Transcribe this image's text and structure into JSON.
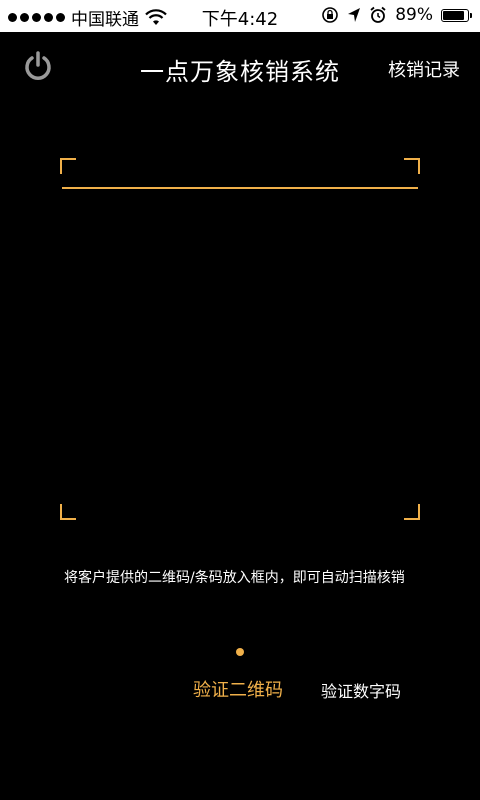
{
  "status_bar": {
    "carrier": "中国联通",
    "time": "下午4:42",
    "battery_percent": "89%",
    "battery_level": 0.89
  },
  "header": {
    "title": "一点万象核销系统",
    "records_label": "核销记录"
  },
  "scanner": {
    "hint": "将客户提供的二维码/条码放入框内，即可自动扫描核销"
  },
  "modes": {
    "qr_label": "验证二维码",
    "numeric_label": "验证数字码"
  },
  "colors": {
    "accent": "#f0b04a",
    "background": "#000000",
    "text": "#ffffff"
  }
}
